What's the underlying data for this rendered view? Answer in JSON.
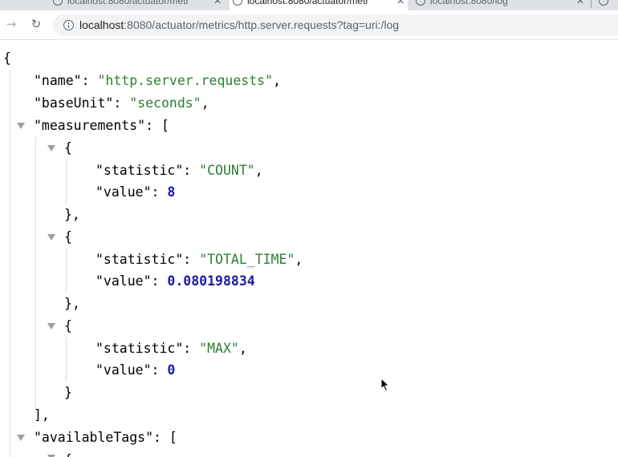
{
  "tabs": [
    {
      "label": "localhost:8080/actuator/metr"
    },
    {
      "label": "localhost:8080/actuator/metr",
      "active": true
    },
    {
      "label": "localhost:8080/log"
    }
  ],
  "address": {
    "host": "localhost",
    "rest": ":8080/actuator/metrics/http.server.requests?tag=uri:/log"
  },
  "json": {
    "open_brace": "{",
    "name_key": "\"name\"",
    "name_value": "\"http.server.requests\"",
    "baseUnit_key": "\"baseUnit\"",
    "baseUnit_value": "\"seconds\"",
    "measurements_key": "\"measurements\"",
    "measurements": [
      {
        "statistic_key": "\"statistic\"",
        "statistic": "\"COUNT\"",
        "value_key": "\"value\"",
        "value": "8"
      },
      {
        "statistic_key": "\"statistic\"",
        "statistic": "\"TOTAL_TIME\"",
        "value_key": "\"value\"",
        "value": "0.080198834"
      },
      {
        "statistic_key": "\"statistic\"",
        "statistic": "\"MAX\"",
        "value_key": "\"value\"",
        "value": "0"
      }
    ],
    "availableTags_key": "\"availableTags\""
  }
}
